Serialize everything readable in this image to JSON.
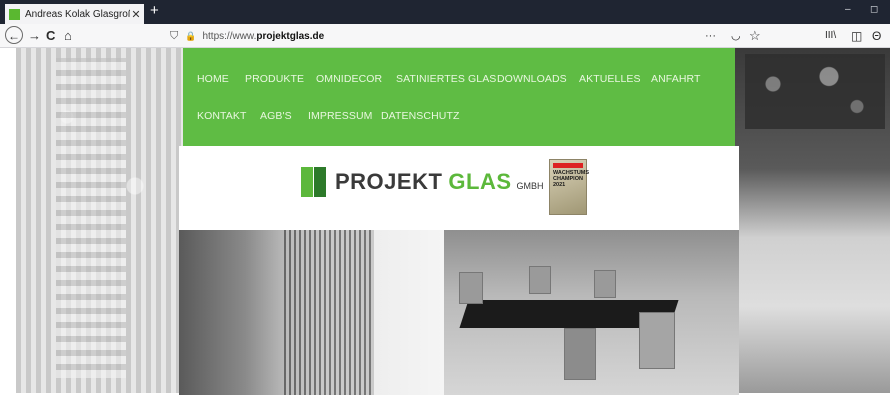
{
  "browser": {
    "tab_title": "Andreas Kolak Glasgroßhandel",
    "tab_close": "✕",
    "new_tab": "+",
    "url_prefix": "https://www.",
    "url_domain": "projektglas.de",
    "minimize": "–",
    "restore": "◻",
    "nav": {
      "back": "←",
      "forward": "→",
      "reload": "C",
      "home": "⌂"
    },
    "tools": {
      "more": "···",
      "pocket": "◡",
      "bookmark": "☆",
      "library": "III\\",
      "sidebar": "◫",
      "account": "Θ"
    }
  },
  "site": {
    "nav_row1": [
      "HOME",
      "PRODUKTE",
      "OMNIDECOR",
      "SATINIERTES GLAS",
      "DOWNLOADS",
      "AKTUELLES",
      "ANFAHRT"
    ],
    "nav_row2": [
      "KONTAKT",
      "AGB'S",
      "IMPRESSUM",
      "DATENSCHUTZ"
    ],
    "logo": {
      "word1": "PROJEKT",
      "word2": "GLAS",
      "word3": "GMBH"
    },
    "badge": {
      "line1": "WACHSTUMS",
      "line2": "CHAMPION",
      "line3": "2021"
    }
  },
  "colors": {
    "nav_green": "#5fbc44",
    "logo_green": "#5cb83b",
    "titlebar": "#1f2532"
  }
}
